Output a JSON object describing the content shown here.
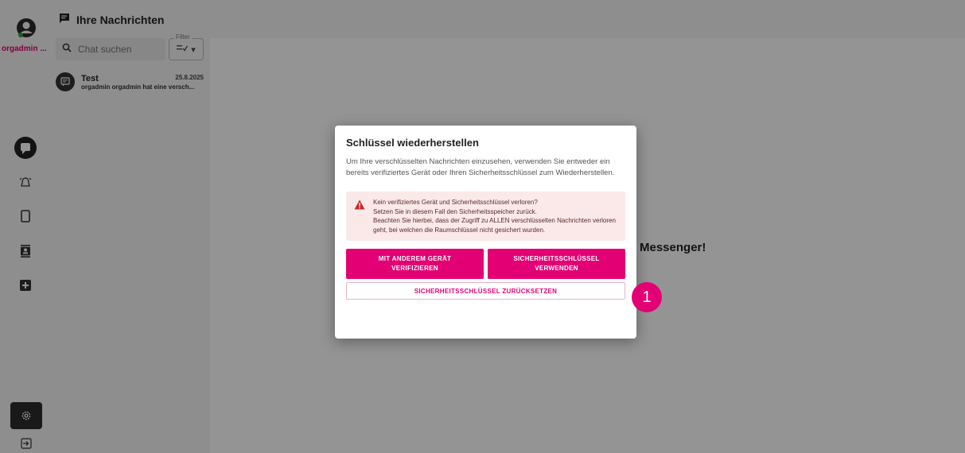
{
  "rail": {
    "username": "orgadmin ...",
    "icons": [
      "chat-icon",
      "alarm-icon",
      "phone-icon",
      "contacts-icon",
      "add-box-icon"
    ],
    "settings_icon": "gear-icon",
    "logout_icon": "logout-icon"
  },
  "chat_list": {
    "header_title": "Ihre Nachrichten",
    "search_placeholder": "Chat suchen",
    "filter_label": "Filter",
    "items": [
      {
        "name": "Test",
        "date": "25.8.2025",
        "preview": "orgadmin orgadmin hat eine versch..."
      }
    ]
  },
  "main": {
    "welcome_fragment": "r Messenger!"
  },
  "dialog": {
    "title": "Schlüssel wiederherstellen",
    "body": "Um Ihre verschlüsselten Nachrichten einzusehen, verwenden Sie entweder ein bereits verifiziertes Gerät oder Ihren Sicherheitsschlüssel zum Wiederherstellen.",
    "alert_lines": [
      "Kein verifiziertes Gerät und Sicherheitsschlüssel verloren?",
      "Setzen Sie in diesem Fall den Sicherheitsspeicher zurück.",
      "Beachten Sie hierbei, dass der Zugriff zu ALLEN verschlüsselten Nachrichten verloren geht, bei welchen die Raumschlüssel nicht gesichert wurden."
    ],
    "btn_other_device_line1": "MIT ANDEREM GERÄT",
    "btn_other_device_line2": "VERIFIZIEREN",
    "btn_security_key_line1": "SICHERHEITSSCHLÜSSEL",
    "btn_security_key_line2": "VERWENDEN",
    "btn_reset": "SICHERHEITSSCHLÜSSEL ZURÜCKSETZEN"
  },
  "step_badge": "1",
  "colors": {
    "accent": "#e20074",
    "alert_bg": "#fbe9e9",
    "alert_icon": "#c62828"
  }
}
